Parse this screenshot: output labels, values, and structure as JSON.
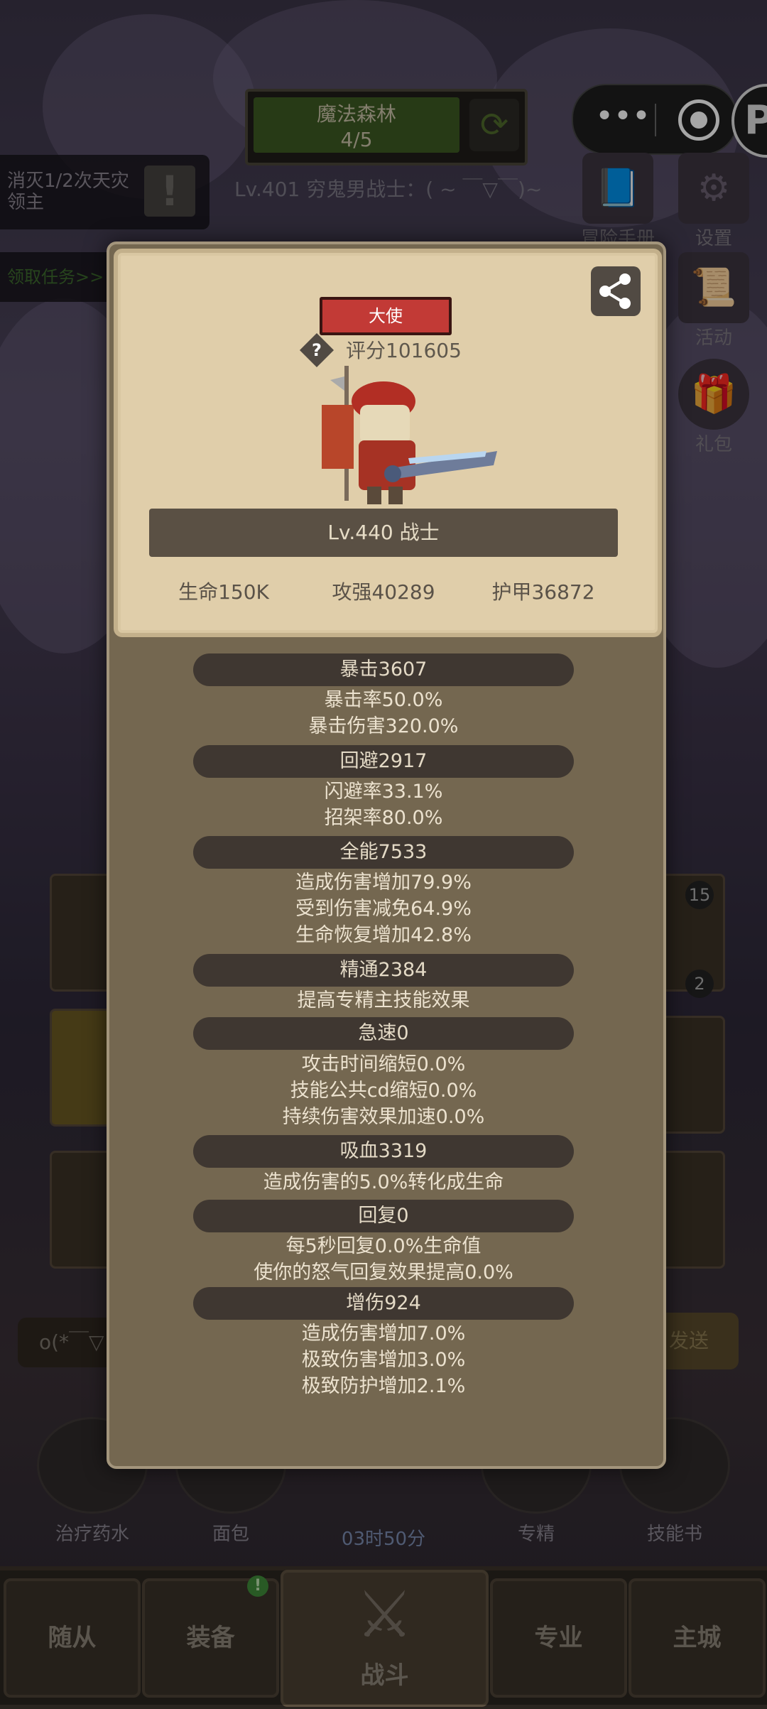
{
  "header": {
    "stage_name": "魔法森林",
    "stage_progress": "4/5",
    "level_line": "Lv.401 穷鬼男战士：( ~ ￣▽￣)~"
  },
  "quest": {
    "text": "消灭1/2次天灾领主",
    "task_link": "领取任务>>"
  },
  "side_icons": [
    {
      "label": "冒险手册",
      "icon": "book-icon"
    },
    {
      "label": "设置",
      "icon": "gear-icon"
    },
    {
      "label": "活动",
      "icon": "scroll-icon"
    },
    {
      "label": "礼包",
      "icon": "gift-icon"
    }
  ],
  "hero_card": {
    "title_badge": "大使",
    "score": "评分101605",
    "level_class": "Lv.440 战士",
    "life": "生命150K",
    "attack": "攻强40289",
    "armor": "护甲36872"
  },
  "stats": [
    {
      "header": "暴击3607",
      "lines": [
        "暴击率50.0%",
        "暴击伤害320.0%"
      ]
    },
    {
      "header": "回避2917",
      "lines": [
        "闪避率33.1%",
        "招架率80.0%"
      ]
    },
    {
      "header": "全能7533",
      "lines": [
        "造成伤害增加79.9%",
        "受到伤害减免64.9%",
        "生命恢复增加42.8%"
      ]
    },
    {
      "header": "精通2384",
      "lines": [
        "提高专精主技能效果"
      ]
    },
    {
      "header": "急速0",
      "lines": [
        "攻击时间缩短0.0%",
        "技能公共cd缩短0.0%",
        "持续伤害效果加速0.0%"
      ]
    },
    {
      "header": "吸血3319",
      "lines": [
        "造成伤害的5.0%转化成生命"
      ]
    },
    {
      "header": "回复0",
      "lines": [
        "每5秒回复0.0%生命值",
        "使你的怒气回复效果提高0.0%"
      ]
    },
    {
      "header": "增伤924",
      "lines": [
        "造成伤害增加7.0%",
        "极致伤害增加3.0%",
        "极致防护增加2.1%"
      ]
    }
  ],
  "chat": {
    "input_text": "o(*￣▽",
    "send_label": "发送"
  },
  "slot_counts": [
    "15",
    "2"
  ],
  "bottom_items": [
    "治疗药水",
    "面包",
    "专精",
    "技能书"
  ],
  "timer": "03时50分",
  "nav": {
    "followers": "随从",
    "equipment": "装备",
    "battle": "战斗",
    "profession": "专业",
    "main_city": "主城",
    "equipment_badge": "!"
  },
  "colors": {
    "badge_red": "#c23a36",
    "card_bg": "#e0ceaa",
    "modal_bg": "#746750",
    "bar_bg": "#3f3731"
  }
}
